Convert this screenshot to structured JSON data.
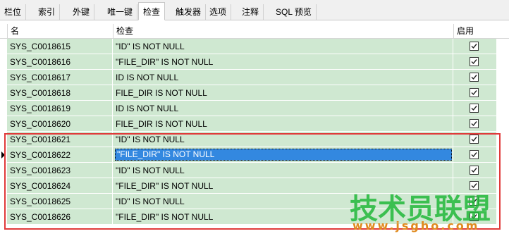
{
  "tabs": [
    {
      "label": "栏位",
      "active": false
    },
    {
      "label": "索引",
      "active": false
    },
    {
      "label": "外键",
      "active": false
    },
    {
      "label": "唯一键",
      "active": false
    },
    {
      "label": "检查",
      "active": true
    },
    {
      "label": "触发器",
      "active": false
    },
    {
      "label": "选项",
      "active": false
    },
    {
      "label": "注释",
      "active": false
    },
    {
      "label": "SQL 预览",
      "active": false
    }
  ],
  "grid": {
    "columns": {
      "name": "名",
      "check": "检查",
      "enabled": "启用"
    },
    "rows": [
      {
        "name": "SYS_C0018615",
        "check": "\"ID\" IS NOT NULL",
        "enabled": true
      },
      {
        "name": "SYS_C0018616",
        "check": "\"FILE_DIR\" IS NOT NULL",
        "enabled": true
      },
      {
        "name": "SYS_C0018617",
        "check": "ID IS NOT NULL",
        "enabled": true
      },
      {
        "name": "SYS_C0018618",
        "check": "FILE_DIR IS NOT NULL",
        "enabled": true
      },
      {
        "name": "SYS_C0018619",
        "check": "ID IS NOT NULL",
        "enabled": true
      },
      {
        "name": "SYS_C0018620",
        "check": "FILE_DIR IS NOT NULL",
        "enabled": true
      },
      {
        "name": "SYS_C0018621",
        "check": "\"ID\" IS NOT NULL",
        "enabled": true
      },
      {
        "name": "SYS_C0018622",
        "check": "\"FILE_DIR\" IS NOT NULL",
        "enabled": true,
        "editing": true
      },
      {
        "name": "SYS_C0018623",
        "check": "\"ID\" IS NOT NULL",
        "enabled": true
      },
      {
        "name": "SYS_C0018624",
        "check": "\"FILE_DIR\" IS NOT NULL",
        "enabled": true
      },
      {
        "name": "SYS_C0018625",
        "check": "\"ID\" IS NOT NULL",
        "enabled": true
      },
      {
        "name": "SYS_C0018626",
        "check": "\"FILE_DIR\" IS NOT NULL",
        "enabled": true
      }
    ]
  },
  "watermark": {
    "text_cn": "技术员联盟",
    "url": "www.jsgho.com"
  },
  "colors": {
    "row_bg": "#cfe8d1",
    "selection": "#3388e0",
    "highlight_border": "#e03a3a"
  }
}
